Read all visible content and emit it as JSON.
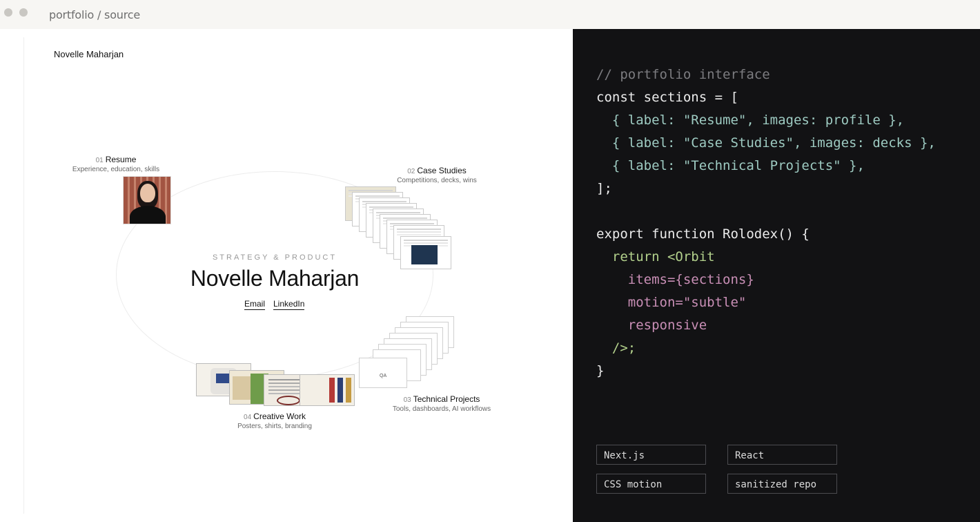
{
  "window": {
    "title": "portfolio / source"
  },
  "preview": {
    "brand": "Novelle Maharjan",
    "eyebrow": "STRATEGY & PRODUCT",
    "name": "Novelle Maharjan",
    "links": {
      "email": "Email",
      "linkedin": "LinkedIn"
    },
    "sections": [
      {
        "num": "01",
        "label": "Resume",
        "sub": "Experience, education, skills"
      },
      {
        "num": "02",
        "label": "Case Studies",
        "sub": "Competitions, decks, wins"
      },
      {
        "num": "03",
        "label": "Technical Projects",
        "sub": "Tools, dashboards, AI workflows"
      },
      {
        "num": "04",
        "label": "Creative Work",
        "sub": "Posters, shirts, branding"
      }
    ],
    "qa_label": "QA"
  },
  "code": {
    "l1": "// portfolio interface",
    "l2": "const sections = [",
    "l3": "  { label: \"Resume\", images: profile },",
    "l4": "  { label: \"Case Studies\", images: decks },",
    "l5": "  { label: \"Technical Projects\" },",
    "l6": "];",
    "l8": "export function Rolodex() {",
    "l9": "  return <Orbit",
    "l10": "    items={sections}",
    "l11": "    motion=\"subtle\"",
    "l12": "    responsive",
    "l13": "  />;",
    "l14": "}"
  },
  "tags": [
    "Next.js",
    "React",
    "CSS motion",
    "sanitized repo"
  ],
  "colors": {
    "code_bg": "#121214",
    "comment": "#7c7c80",
    "string": "#9ecbc2",
    "keyword": "#b3d18c",
    "prop": "#c98fb6"
  }
}
